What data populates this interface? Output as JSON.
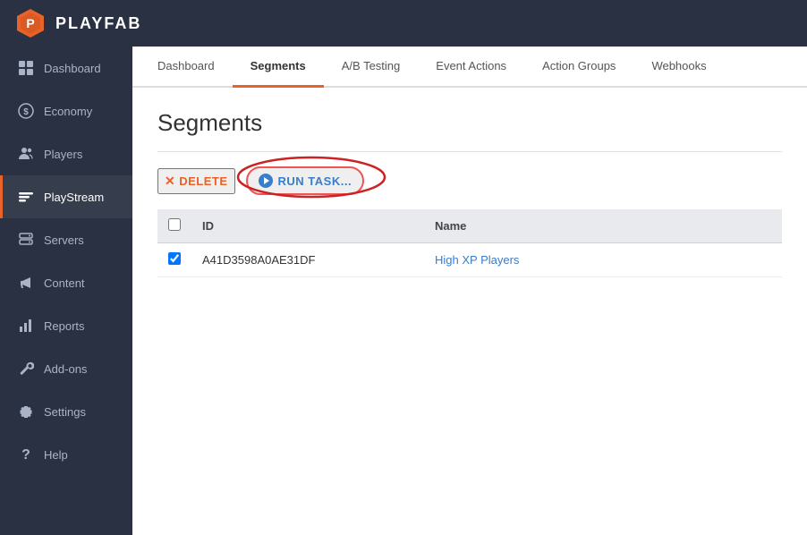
{
  "app": {
    "name": "PLAYFAB"
  },
  "sidebar": {
    "items": [
      {
        "id": "dashboard",
        "label": "Dashboard",
        "icon": "grid"
      },
      {
        "id": "economy",
        "label": "Economy",
        "icon": "coin"
      },
      {
        "id": "players",
        "label": "Players",
        "icon": "people"
      },
      {
        "id": "playstream",
        "label": "PlayStream",
        "icon": "stream",
        "active": true
      },
      {
        "id": "servers",
        "label": "Servers",
        "icon": "server"
      },
      {
        "id": "content",
        "label": "Content",
        "icon": "megaphone"
      },
      {
        "id": "reports",
        "label": "Reports",
        "icon": "chart"
      },
      {
        "id": "addons",
        "label": "Add-ons",
        "icon": "wrench"
      },
      {
        "id": "settings",
        "label": "Settings",
        "icon": "gear"
      },
      {
        "id": "help",
        "label": "Help",
        "icon": "question"
      }
    ]
  },
  "tabs": [
    {
      "id": "dashboard",
      "label": "Dashboard",
      "active": false
    },
    {
      "id": "segments",
      "label": "Segments",
      "active": true
    },
    {
      "id": "abtesting",
      "label": "A/B Testing",
      "active": false
    },
    {
      "id": "eventactions",
      "label": "Event Actions",
      "active": false
    },
    {
      "id": "actiongroups",
      "label": "Action Groups",
      "active": false
    },
    {
      "id": "webhooks",
      "label": "Webhooks",
      "active": false
    }
  ],
  "page": {
    "title": "Segments"
  },
  "actions": {
    "delete_label": "DELETE",
    "run_task_label": "RUN TASK..."
  },
  "table": {
    "columns": [
      {
        "id": "checkbox",
        "label": ""
      },
      {
        "id": "id",
        "label": "ID"
      },
      {
        "id": "name",
        "label": "Name"
      }
    ],
    "rows": [
      {
        "checked": true,
        "id": "A41D3598A0AE31DF",
        "name": "High XP Players"
      }
    ]
  }
}
